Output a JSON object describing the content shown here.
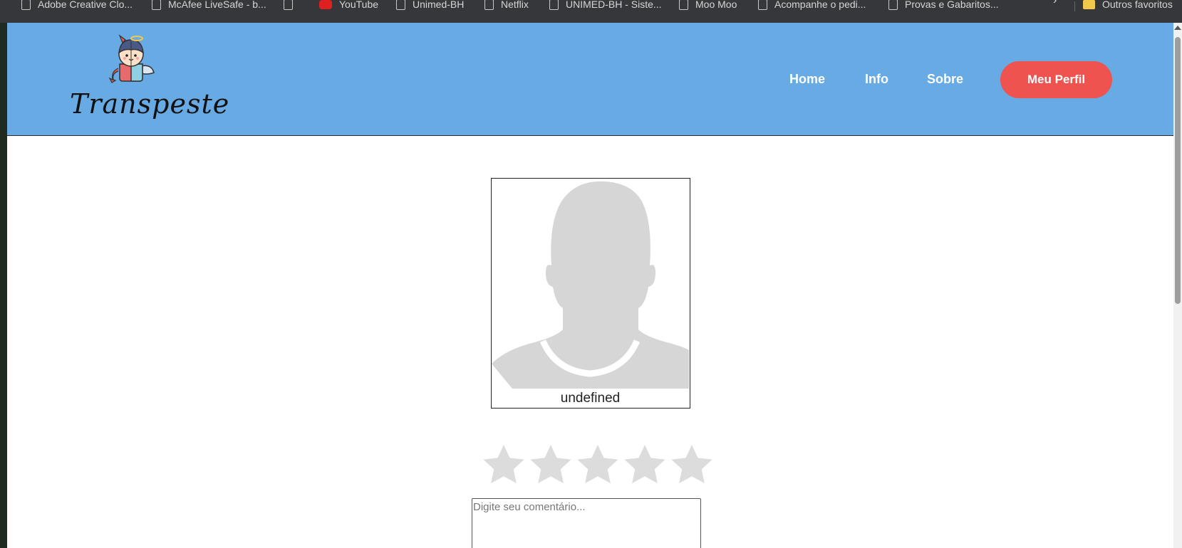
{
  "bookmarks": {
    "items": [
      {
        "label": "Adobe Creative Clo..."
      },
      {
        "label": "McAfee LiveSafe - b..."
      },
      {
        "label": ""
      },
      {
        "label": "YouTube"
      },
      {
        "label": "Unimed-BH"
      },
      {
        "label": "Netflix"
      },
      {
        "label": "UNIMED-BH - Siste..."
      },
      {
        "label": "Moo Moo"
      },
      {
        "label": "Acompanhe o pedi..."
      },
      {
        "label": "Provas e Gabaritos..."
      }
    ],
    "overflow": "›",
    "other_folder": "Outros favoritos"
  },
  "header": {
    "logo_text": "Transpeste",
    "nav": {
      "home": "Home",
      "info": "Info",
      "sobre": "Sobre",
      "profile_button": "Meu Perfil"
    }
  },
  "profile": {
    "name": "undefined"
  },
  "rating": {
    "stars": 5,
    "value": 0
  },
  "comment": {
    "placeholder": "Digite seu comentário...",
    "value": ""
  },
  "colors": {
    "header_bg": "#67aae4",
    "accent": "#ef5350",
    "star_inactive": "#dcdcdc"
  }
}
